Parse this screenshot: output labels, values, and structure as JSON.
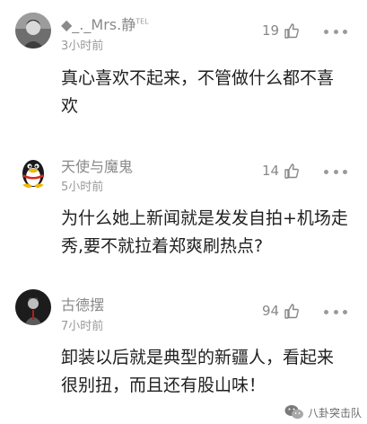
{
  "comments": [
    {
      "username": "◆_._Mrs.静",
      "username_suffix": "TEL",
      "time": "3小时前",
      "likes": "19",
      "text": "真心喜欢不起来，不管做什么都不喜欢",
      "avatar": "grayscale-portrait"
    },
    {
      "username": "天使与魔鬼",
      "time": "5小时前",
      "likes": "14",
      "text": "为什么她上新闻就是发发自拍+机场走秀,要不就拉着郑爽刷热点?",
      "avatar": "qq-penguin"
    },
    {
      "username": "古德摆",
      "time": "7小时前",
      "likes": "94",
      "text": "卸装以后就是典型的新疆人，看起来很别扭，而且还有股山味！",
      "avatar": "dark-portrait"
    }
  ],
  "watermark": {
    "text": "八卦突击队"
  },
  "icons": {
    "like": "thumbs-up-icon",
    "more": "more-dots-icon",
    "watermark": "wechat-icon"
  },
  "colors": {
    "text": "#1f1f1f",
    "meta": "#8a8a8a"
  }
}
